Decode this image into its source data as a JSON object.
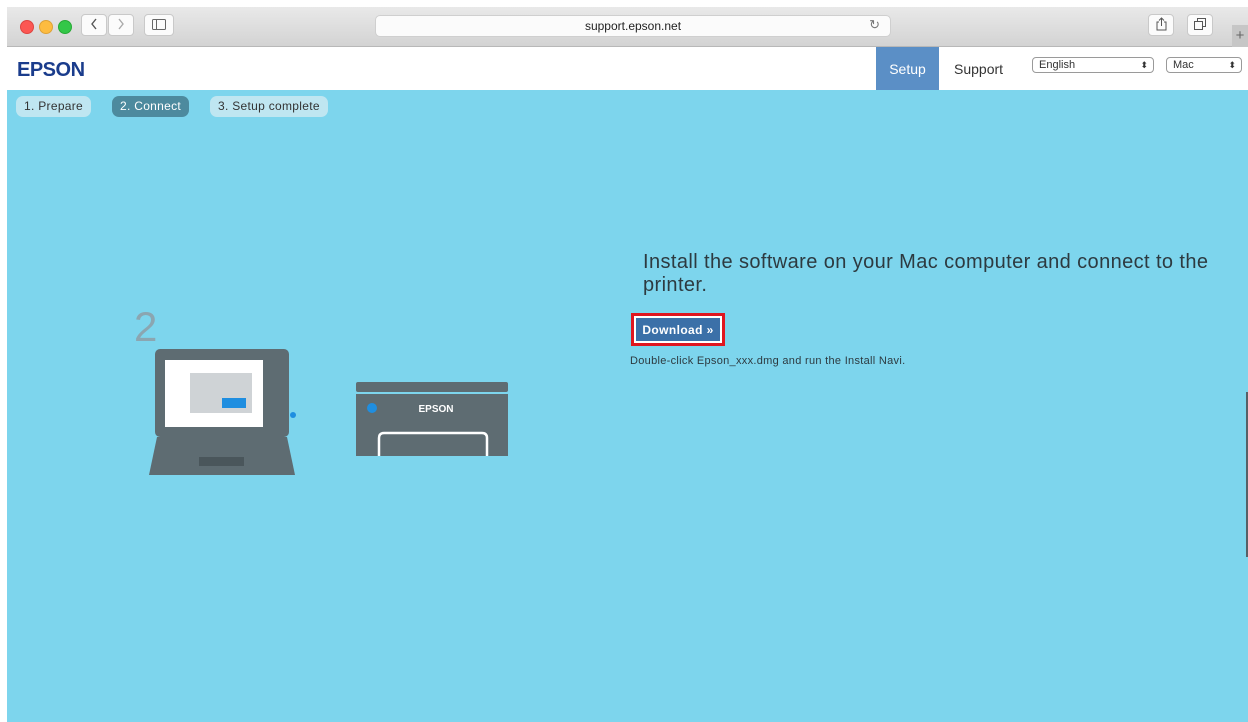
{
  "browser": {
    "url": "support.epson.net",
    "traffic_light_colors": [
      "#fc5753",
      "#fdbc40",
      "#33c748"
    ],
    "icons": [
      "back-icon",
      "forward-icon",
      "sidebar-icon",
      "reload-icon",
      "share-icon",
      "tabs-icon",
      "new-tab-icon"
    ]
  },
  "header": {
    "logo": "EPSON",
    "nav": {
      "setup": "Setup",
      "support": "Support"
    },
    "language_select": "English",
    "os_select": "Mac",
    "accent_color": "#5b8fc6"
  },
  "steps": [
    {
      "label": "1. Prepare",
      "active": false
    },
    {
      "label": "2. Connect",
      "active": true
    },
    {
      "label": "3. Setup complete",
      "active": false
    }
  ],
  "illustration": {
    "step_number": "2",
    "printer_brand": "EPSON"
  },
  "main": {
    "heading": "Install the software on your Mac computer and connect to the printer.",
    "download_button": "Download »",
    "note": "Double-click Epson_xxx.dmg and run the Install Navi.",
    "highlight_color": "#e0161f"
  },
  "page_background": "#7dd5ed"
}
